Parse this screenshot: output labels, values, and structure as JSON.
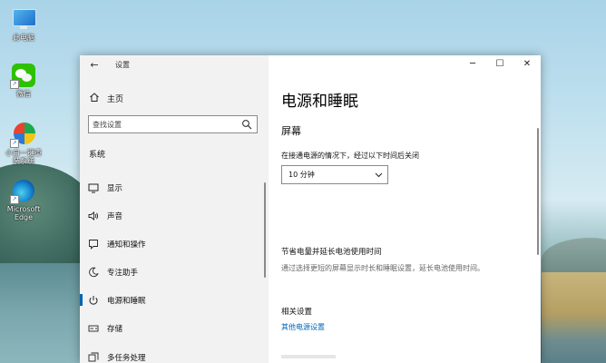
{
  "desktop": {
    "icons": [
      {
        "label": "此电脑",
        "icon": "this-pc-icon"
      },
      {
        "label": "微信",
        "icon": "wechat-icon"
      },
      {
        "label": "小白一键重装系统",
        "icon": "reinstall-tool-icon"
      },
      {
        "label": "Microsoft Edge",
        "icon": "edge-icon"
      }
    ]
  },
  "window": {
    "title": "设置",
    "back_glyph": "←",
    "controls": {
      "minimize": "─",
      "maximize": "☐",
      "close": "✕"
    }
  },
  "sidebar": {
    "home_label": "主页",
    "search_placeholder": "查找设置",
    "section_label": "系统",
    "items": [
      {
        "label": "显示",
        "icon": "display-icon"
      },
      {
        "label": "声音",
        "icon": "sound-icon"
      },
      {
        "label": "通知和操作",
        "icon": "notification-icon"
      },
      {
        "label": "专注助手",
        "icon": "focus-assist-icon"
      },
      {
        "label": "电源和睡眠",
        "icon": "power-icon",
        "active": true
      },
      {
        "label": "存储",
        "icon": "storage-icon"
      },
      {
        "label": "多任务处理",
        "icon": "multitasking-icon"
      }
    ]
  },
  "content": {
    "page_title": "电源和睡眠",
    "screen_header": "屏幕",
    "screen_label": "在接通电源的情况下，经过以下时间后关闭",
    "screen_value": "10 分钟",
    "sleep_header": "节省电量并延长电池使用时间",
    "sleep_desc": "通过选择更短的屏幕显示时长和睡眠设置，延长电池使用时间。",
    "related_header": "相关设置",
    "related_link": "其他电源设置"
  },
  "colors": {
    "accent": "#0063b1",
    "link": "#0067b8",
    "sidebar_bg": "#f2f2f2"
  }
}
